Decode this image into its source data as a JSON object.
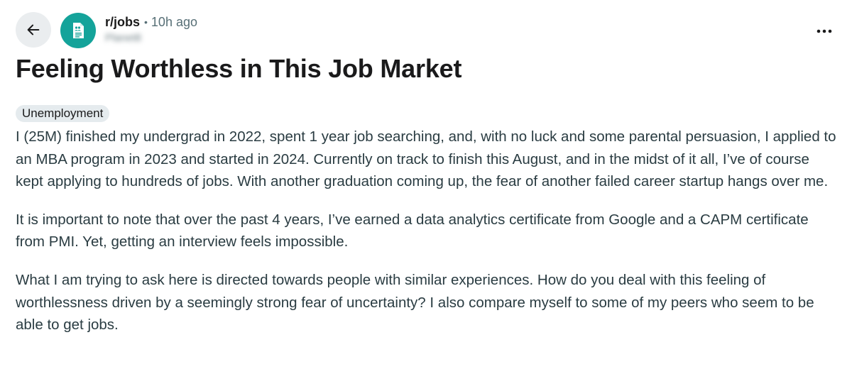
{
  "header": {
    "back_icon": "arrow-left-icon",
    "subreddit_icon": "document-people-icon",
    "subreddit_name": "r/jobs",
    "separator": "•",
    "time_ago": "10h ago",
    "author": "Planet8",
    "more_icon": "ellipsis-horizontal-icon"
  },
  "post": {
    "title": "Feeling Worthless in This Job Market",
    "flair": "Unemployment",
    "paragraphs": [
      "I (25M) finished my undergrad in 2022, spent 1 year job searching, and, with no luck and some parental persuasion, I applied to an MBA program in 2023 and started in 2024. Currently on track to finish this August, and in the midst of it all, I’ve of course kept applying to hundreds of jobs. With another graduation coming up, the fear of another failed career startup hangs over me.",
      "It is important to note that over the past 4 years, I’ve earned a data analytics certificate from Google and a CAPM certificate from PMI. Yet, getting an interview feels impossible.",
      "What I am trying to ask here is directed towards people with similar experiences. How do you deal with this feeling of worthlessness driven by a seemingly strong fear of uncertainty? I also compare myself to some of my peers who seem to be able to get jobs."
    ]
  },
  "colors": {
    "avatar_bg": "#14a39a",
    "button_bg": "#eaedef",
    "flair_bg": "#e5ebee",
    "body_text": "#2a3c42",
    "meta_text": "#576f76"
  }
}
